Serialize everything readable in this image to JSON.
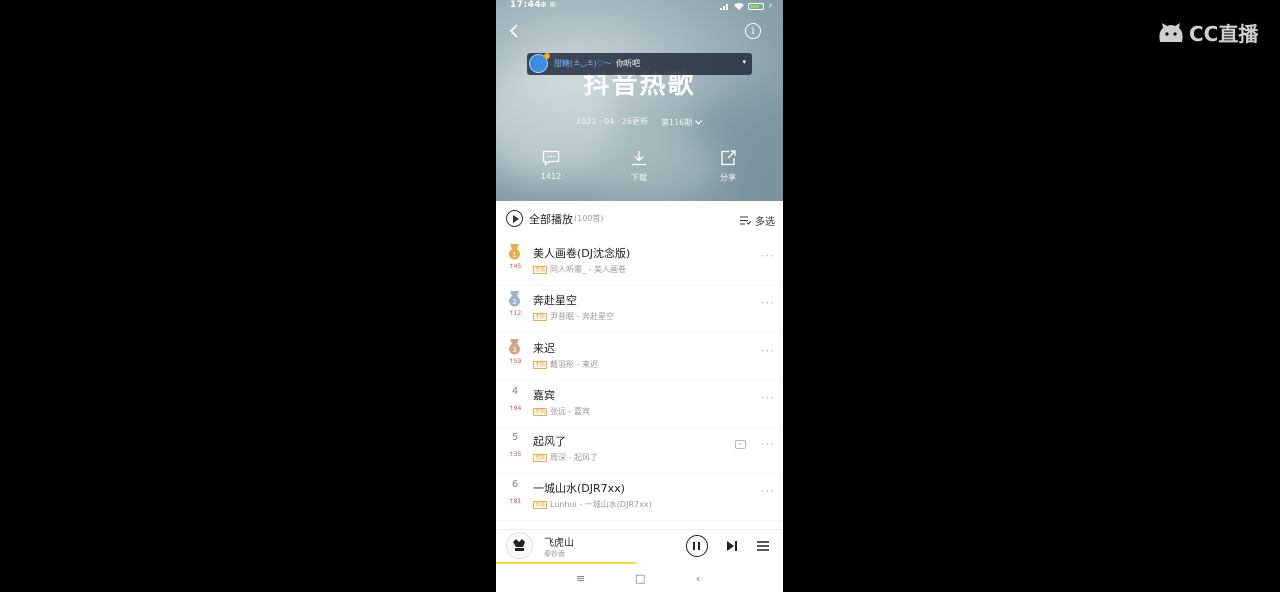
{
  "watermark": {
    "text": "CC直播"
  },
  "status_bar": {
    "time": "17:44"
  },
  "header": {
    "big_title": "抖音热歌",
    "overlay": {
      "text_a": "甜糖(≗◡≗)♡～",
      "text_b": "你听吧",
      "dropdown": "▾"
    },
    "date": "2021 · 04 · 26更新",
    "issue": "第116期"
  },
  "actions": [
    {
      "label": "1412",
      "icon": "comment-icon"
    },
    {
      "label": "下载",
      "icon": "download-icon"
    },
    {
      "label": "分享",
      "icon": "share-icon"
    }
  ],
  "list_header": {
    "play_all": "全部播放",
    "count": "(100首)",
    "multi_select": "多选"
  },
  "songs": [
    {
      "rank": "1",
      "trend": "↑45",
      "title": "美人画卷(DJ沈念版)",
      "tag": "无损",
      "artist": "同人听書_ - 美人画卷"
    },
    {
      "rank": "2",
      "trend": "↑12",
      "title": "奔赴星空",
      "tag": "无损",
      "artist": "尹昔眠 - 奔赴星空"
    },
    {
      "rank": "3",
      "trend": "↑59",
      "title": "来迟",
      "tag": "无损",
      "artist": "戴羽彤 - 来迟"
    },
    {
      "rank": "4",
      "trend": "↑94",
      "title": "嘉宾",
      "tag": "无损",
      "artist": "张远 - 嘉宾"
    },
    {
      "rank": "5",
      "trend": "↑35",
      "title": "起风了",
      "tag": "无损",
      "artist": "周深 - 起风了"
    },
    {
      "rank": "6",
      "trend": "↑81",
      "title": "一城山水(DJR7xx)",
      "tag": "无损",
      "artist": "Lunhui - 一城山水(DJR7xx)"
    }
  ],
  "player": {
    "title": "飞虎山",
    "artist": "秦钞香"
  },
  "colors": {
    "medal_gold": "#e8b04a",
    "medal_silver": "#9fb4c4",
    "medal_bronze": "#d4a488",
    "progress": "#ffd92e"
  }
}
